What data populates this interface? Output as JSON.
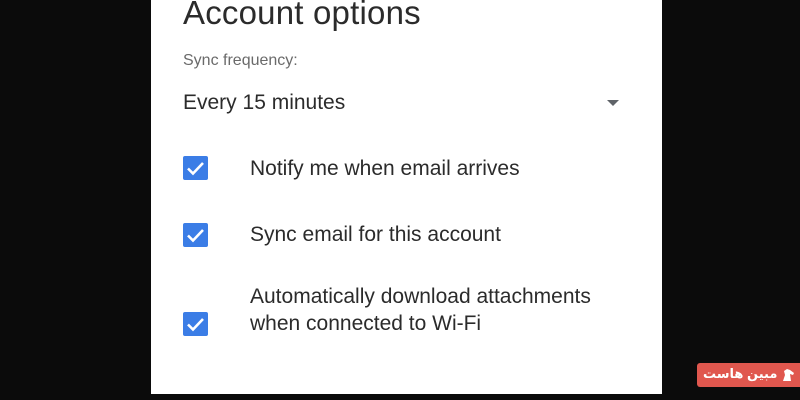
{
  "header": {
    "title": "Account options"
  },
  "sync": {
    "label": "Sync frequency:",
    "selected": "Every 15 minutes"
  },
  "options": [
    {
      "label": "Notify me when email arrives",
      "checked": true
    },
    {
      "label": "Sync email for this account",
      "checked": true
    },
    {
      "label": "Automatically download attachments when connected to Wi-Fi",
      "checked": true
    }
  ],
  "watermark": {
    "text": "مبين هاست"
  },
  "colors": {
    "accent": "#3b7de6",
    "watermark": "#e0574e",
    "background": "#0b0b0b"
  }
}
